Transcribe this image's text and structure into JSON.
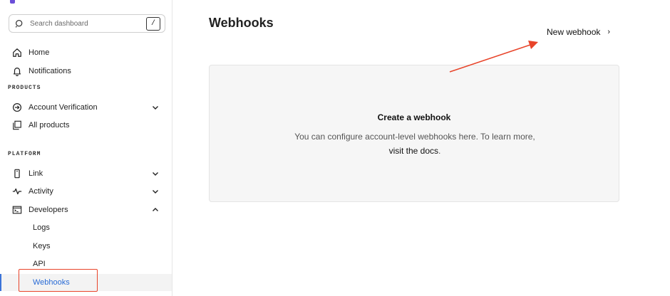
{
  "sidebar": {
    "search": {
      "placeholder": "Search dashboard",
      "shortcut": "/"
    },
    "top_items": [
      {
        "label": "Home",
        "icon": "home-icon"
      },
      {
        "label": "Notifications",
        "icon": "bell-icon"
      }
    ],
    "products_label": "PRODUCTS",
    "products": [
      {
        "label": "Account Verification",
        "icon": "arrow-circle-icon",
        "expandable": true
      },
      {
        "label": "All products",
        "icon": "copy-stack-icon"
      }
    ],
    "platform_label": "PLATFORM",
    "platform": [
      {
        "label": "Link",
        "icon": "phone-icon",
        "expandable": true
      },
      {
        "label": "Activity",
        "icon": "pulse-icon",
        "expandable": true
      },
      {
        "label": "Developers",
        "icon": "terminal-icon",
        "expanded": true
      }
    ],
    "developer_subitems": [
      "Logs",
      "Keys",
      "API",
      "Webhooks"
    ],
    "active_subitem": "Webhooks"
  },
  "main": {
    "title": "Webhooks",
    "new_webhook_label": "New webhook",
    "empty_state": {
      "title": "Create a webhook",
      "desc_prefix": "You can configure account-level webhooks here. To learn more, ",
      "link_text": "visit the docs",
      "desc_suffix": "."
    }
  },
  "colors": {
    "accent": "#2a6cd6",
    "annotation": "#e8442a",
    "card_bg": "#f6f6f6"
  }
}
